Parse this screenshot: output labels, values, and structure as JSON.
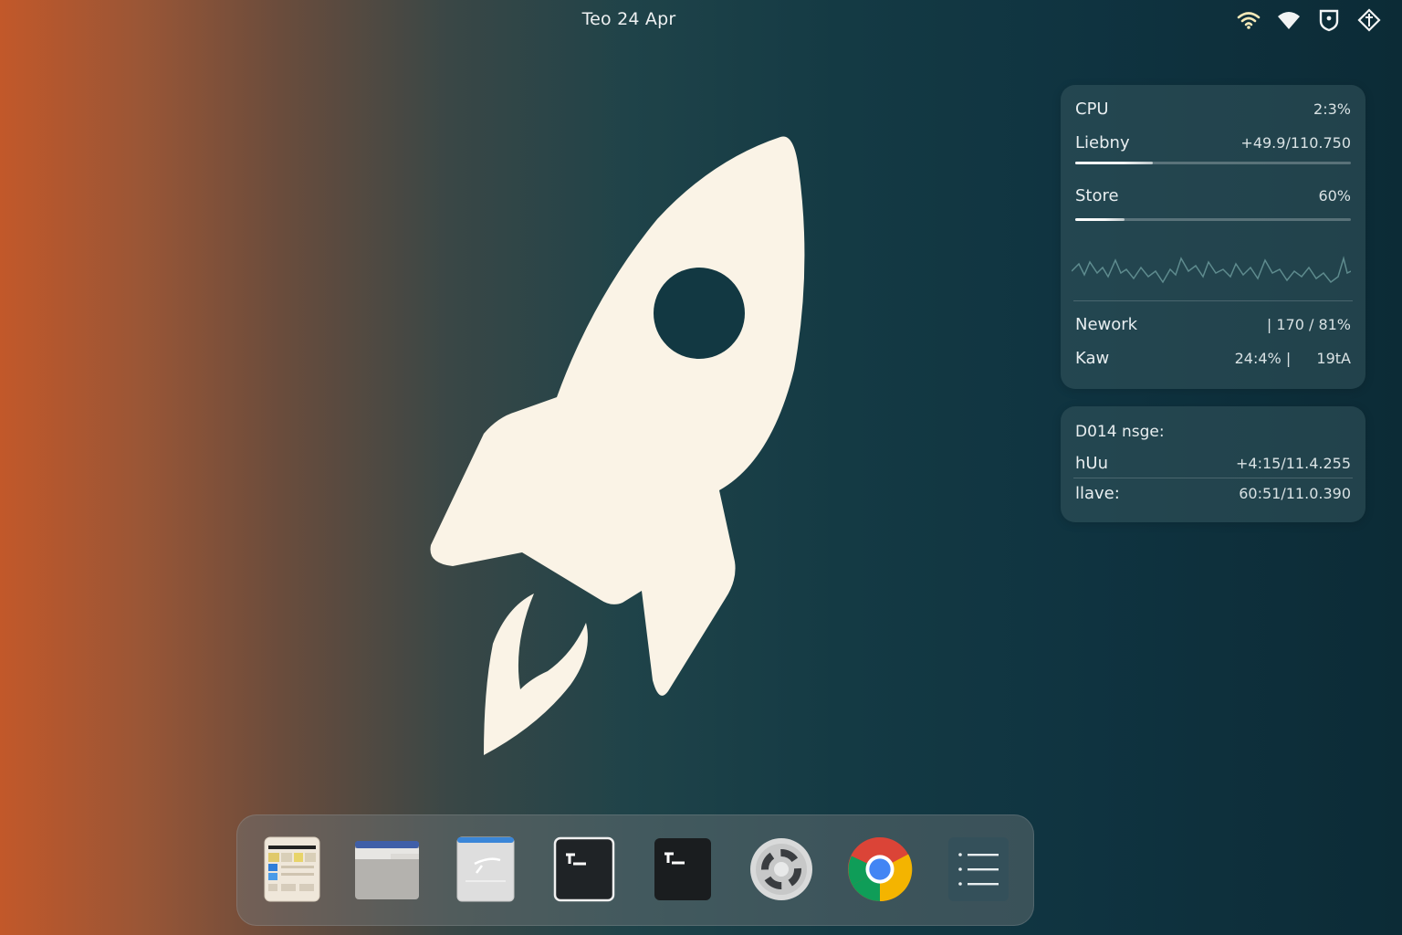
{
  "topbar": {
    "date": "Teo 24 Apr",
    "tray_icons": [
      "wifi-icon",
      "wifi-strong-icon",
      "shield-icon",
      "network-diamond-icon"
    ]
  },
  "wallpaper": {
    "icon": "rocket-icon",
    "colors": {
      "left": "#c2582a",
      "right": "#0c2b36",
      "rocket": "#faf3e6"
    }
  },
  "monitor_widget": {
    "cpu": {
      "label": "CPU",
      "value": "2:3%"
    },
    "library": {
      "label": "Liebny",
      "value": "+49.9∕110.750",
      "progress": 0.28
    },
    "store": {
      "label": "Store",
      "value": "60%",
      "progress": 0.18
    },
    "network": {
      "label": "Nework",
      "value": "| 170 ∕ 81%"
    },
    "kaw": {
      "label": "Kaw",
      "value_a": "24:4% |",
      "value_b": "19tA"
    }
  },
  "disk_widget": {
    "title": "D014 nsge:",
    "rows": [
      {
        "label": "hUu",
        "value": "+4:15∕11.4.255"
      },
      {
        "label": "llave:",
        "value": "60:51∕11.0.390"
      }
    ]
  },
  "dock": {
    "apps": [
      {
        "name": "spreadsheet-app-icon"
      },
      {
        "name": "folder-app-icon"
      },
      {
        "name": "text-editor-app-icon"
      },
      {
        "name": "terminal-app-icon"
      },
      {
        "name": "terminal-dark-app-icon"
      },
      {
        "name": "settings-app-icon"
      },
      {
        "name": "chrome-app-icon"
      },
      {
        "name": "app-list-icon"
      }
    ]
  }
}
